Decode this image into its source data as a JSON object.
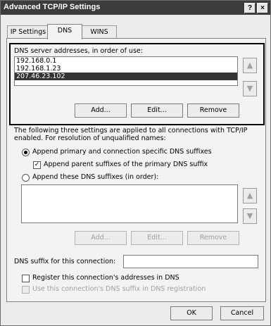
{
  "window": {
    "title": "Advanced TCP/IP Settings",
    "help_glyph": "?",
    "close_glyph": "×"
  },
  "tabs": [
    {
      "label": "IP Settings",
      "active": false
    },
    {
      "label": "DNS",
      "active": true
    },
    {
      "label": "WINS",
      "active": false
    }
  ],
  "dns_servers": {
    "label": "DNS server addresses, in order of use:",
    "items": [
      "192.168.0.1",
      "192.168.1.23",
      "207.46.23.102"
    ],
    "selected_index": 2,
    "buttons": {
      "add": "Add...",
      "edit": "Edit...",
      "remove": "Remove"
    }
  },
  "info_text": "The following three settings are applied to all connections with TCP/IP enabled. For resolution of unqualified names:",
  "options": {
    "append_primary": "Append primary and connection specific DNS suffixes",
    "append_parent": "Append parent suffixes of the primary DNS suffix",
    "append_these": "Append these DNS suffixes (in order):"
  },
  "suffix_buttons": {
    "add": "Add...",
    "edit": "Edit...",
    "remove": "Remove"
  },
  "dns_suffix_label": "DNS suffix for this connection:",
  "dns_suffix_value": "",
  "register_label": "Register this connection's addresses in DNS",
  "use_suffix_label": "Use this connection's DNS suffix in DNS registration",
  "footer": {
    "ok": "OK",
    "cancel": "Cancel"
  },
  "icons": {
    "up": "▲",
    "down": "▼"
  }
}
